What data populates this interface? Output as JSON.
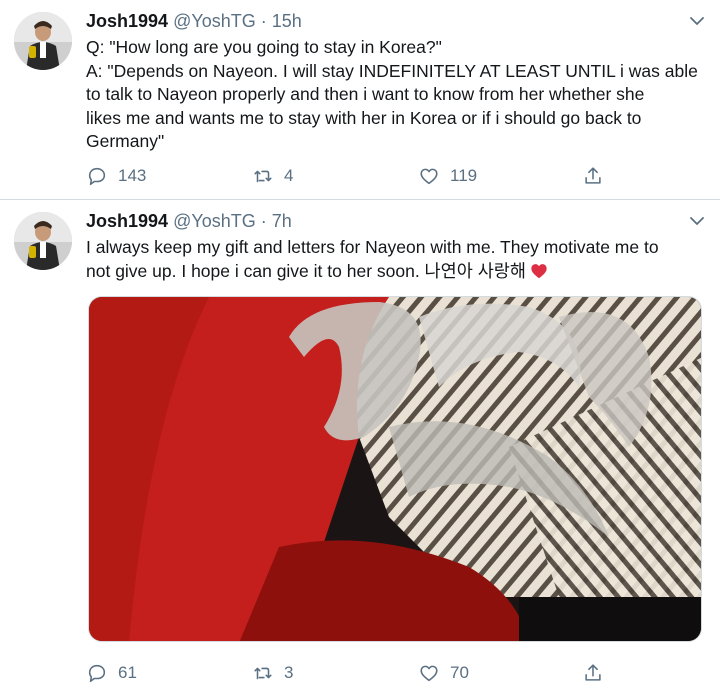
{
  "tweets": [
    {
      "name": "Josh1994",
      "handle": "@YoshTG",
      "dot": "·",
      "time": "15h",
      "lines": [
        "Q: \"How long are you going to stay in Korea?\"",
        "A: \"Depends on Nayeon. I will stay INDEFINITELY AT LEAST UNTIL i was able",
        "to talk to Nayeon properly and then i want to know from her whether she",
        "likes me and wants me to stay with her in Korea or if i should go back to",
        "Germany\""
      ],
      "replies": "143",
      "retweets": "4",
      "likes": "119"
    },
    {
      "name": "Josh1994",
      "handle": "@YoshTG",
      "dot": "·",
      "time": "7h",
      "lines": [
        "I always keep my gift and letters for Nayeon with me. They motivate me to",
        "not give up. I hope i can give it to her soon. 나연아 사랑해"
      ],
      "emoji": "red-heart",
      "replies": "61",
      "retweets": "3",
      "likes": "70"
    }
  ],
  "icons": {
    "reply": "reply-icon",
    "retweet": "retweet-icon",
    "like": "like-icon",
    "share": "share-icon",
    "more": "chevron-down-icon"
  },
  "colors": {
    "text": "#14171a",
    "muted": "#5b7083",
    "heart": "#e0245e",
    "border": "#d4dbe0"
  }
}
